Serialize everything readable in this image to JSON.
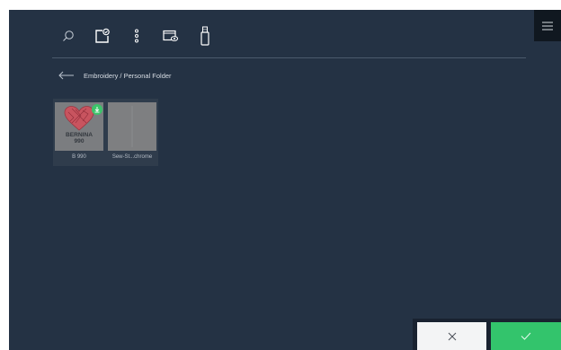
{
  "toolbar": {
    "icons": [
      "search-icon",
      "new-design-icon",
      "more-options-icon",
      "preview-icon",
      "usb-stick-icon"
    ]
  },
  "menu": {
    "icon": "hamburger-menu-icon"
  },
  "breadcrumb": {
    "path": "Embroidery / Personal Folder"
  },
  "files": [
    {
      "name": "B 990",
      "thumbnail": "heart-embroidery",
      "brand_line1": "BERNINA",
      "brand_line2": "990",
      "badge": "download-icon"
    },
    {
      "name": "Sew-St...chrome",
      "thumbnail": "blank-stitch"
    }
  ],
  "actions": {
    "cancel_icon": "close-icon",
    "confirm_icon": "checkmark-icon"
  },
  "colors": {
    "background": "#243244",
    "confirm": "#33c46c",
    "badge": "#3cc46a",
    "heart": "#c8545f"
  }
}
